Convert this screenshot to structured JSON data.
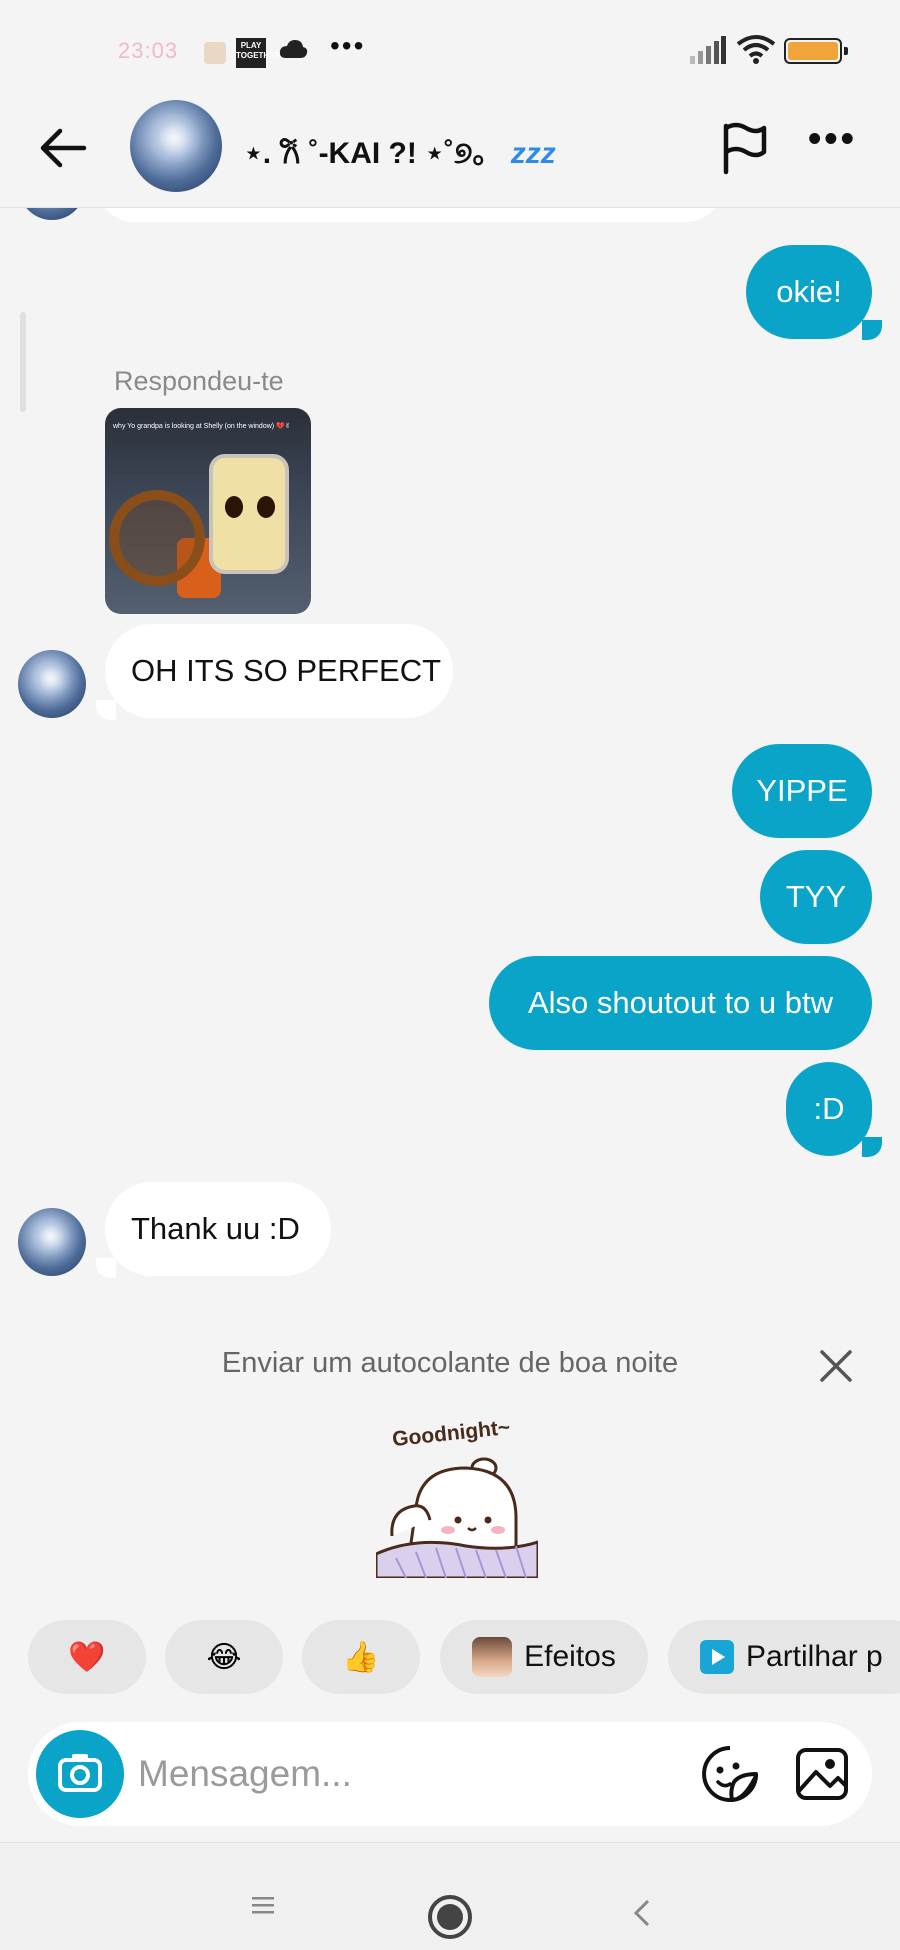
{
  "status_bar": {
    "time": "23:03",
    "app_badge_text": "PLAY TOGETHER"
  },
  "header": {
    "name_main": "⋆. 𐙚 ˚-KAI ?! ⋆˚୭。",
    "name_zz": "zzz",
    "back_icon": "arrow-left-icon",
    "flag_icon": "flag-icon",
    "more_icon": "more-horizontal-icon"
  },
  "messages": [
    {
      "id": "m1",
      "side": "out",
      "text": "okie!"
    },
    {
      "id": "m2",
      "side": "in",
      "reply_label": "Respondeu-te",
      "thumb_caption": "why Yo grandpa is looking at Shelly (on the window) 💔✌",
      "text": "OH ITS SO PERFECT"
    },
    {
      "id": "m3",
      "side": "out",
      "text": "YIPPE"
    },
    {
      "id": "m4",
      "side": "out",
      "text": "TYY"
    },
    {
      "id": "m5",
      "side": "out",
      "text": "Also shoutout to u btw"
    },
    {
      "id": "m6",
      "side": "out",
      "text": ":D"
    },
    {
      "id": "m7",
      "side": "in",
      "text": "Thank uu :D"
    }
  ],
  "sticker_suggestion": {
    "title": "Enviar um autocolante de boa noite",
    "sticker_text": "Goodnight~"
  },
  "quick_actions": [
    {
      "emoji": "❤️"
    },
    {
      "emoji": "😂"
    },
    {
      "emoji": "👍"
    },
    {
      "label": "Efeitos"
    },
    {
      "label": "Partilhar p"
    }
  ],
  "composer": {
    "placeholder": "Mensagem..."
  },
  "colors": {
    "accent": "#0aa4c9",
    "background": "#f4f4f4",
    "incoming_bubble": "#ffffff"
  }
}
